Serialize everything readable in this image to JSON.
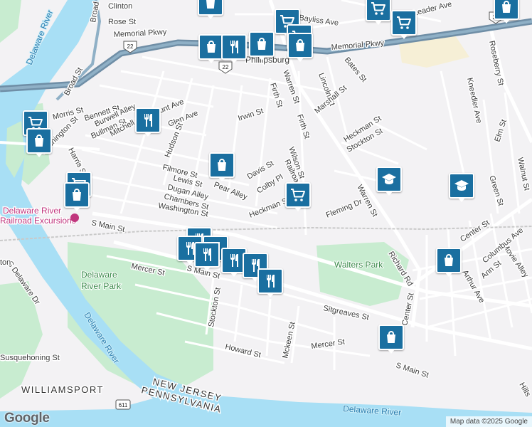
{
  "map": {
    "attribution": "Map data ©2025 Google",
    "logo_text": "Google",
    "water_color": "#a8dff5",
    "park_color": "#c8ecd0",
    "highway_color": "#6f8ea6",
    "pin_color": "#1a6fa0",
    "labels": {
      "broad_st_top": "Broad St",
      "clinton": "Clinton",
      "rose_st": "Rose St",
      "bayliss_ave": "Bayliss Ave",
      "leader_ave": "Leader Ave",
      "memorial_pkwy_left": "Memorial Pkwy",
      "memorial_pkwy_right": "Memorial Pkwy",
      "phillipsburg": "Phillipsburg",
      "broad_st_left": "Broad St",
      "delaware_river_top": "Delaware River",
      "roseberry_st": "Roseberry St",
      "bates_st": "Bates St",
      "lincoln_st": "Lincoln St",
      "marshall_st": "Marshall St",
      "firth_st_top": "Firth St",
      "warren_st_top": "Warren St",
      "kneedler_ave": "Kneedler Ave",
      "morris_st": "Morris St",
      "bennett_st": "Bennett St",
      "burwell_alley": "Burwell Alley",
      "bullman_st": "Bullman St",
      "mitchell_st": "Mitchell St",
      "hunt_ave": "Hunt Ave",
      "glen_ave": "Glen Ave",
      "irwin_st": "Irwin St",
      "hudson_st": "Hudson St",
      "firth_st_mid": "Firth St",
      "heckman_st_top": "Heckman St",
      "stockton_st_top": "Stockton St",
      "elm_st": "Elm St",
      "walnut_st": "Walnut St",
      "harris_st": "Harris St",
      "washington_st_left": "Washington St",
      "filmore_st": "Filmore St",
      "pear_alley": "Pear Alley",
      "wilson_st": "Wilson St",
      "davis_st": "Davis St",
      "colby_pl": "Colby Pl",
      "railroad_ave": "Railroad Ave",
      "lewis_st": "Lewis St",
      "dugan_alley": "Dugan Alley",
      "chambers_st": "Chambers St",
      "heckman_st": "Heckman St",
      "green_st": "Green St",
      "fleming_dr": "Fleming Dr",
      "warren_st": "Warren St",
      "delaware_river_excursions_1": "Delaware River",
      "delaware_river_excursions_2": "Railroad Excursions",
      "washington_st": "Washington St",
      "s_main_st_left": "S Main St",
      "center_st": "Center St",
      "movie_alley": "Movie Alley",
      "columbus_ave": "Columbus Ave",
      "walters_park": "Walters Park",
      "richard_rd": "Richard Rd",
      "ann_st": "Ann St",
      "arthur_ave": "Arthur Ave",
      "s_main_st_mid": "S Main St",
      "mercer_st_left": "Mercer St",
      "stockton_st": "Stockton St",
      "delaware_river_park_1": "Delaware",
      "delaware_river_park_2": "River Park",
      "center_st_vert": "Center St",
      "sitgreaves_st": "Sitgreaves St",
      "s_delaware_dr": "S Delaware Dr",
      "delaware_river_mid": "Delaware River",
      "mckeen_st": "Mckeen St",
      "mercer_st": "Mercer St",
      "howard_st": "Howard St",
      "s_main_st_right": "S Main St",
      "susquehanna_st": "Susquehoning St",
      "williamsport": "WILLIAMSPORT",
      "new_jersey": "NEW JERSEY",
      "pennsylvania": "PENNSYLVANIA",
      "route_611": "611",
      "delaware_river_bottom": "Delaware River",
      "delaware_river_left": "Delaware River",
      "hills": "Hills",
      "ton": "ton",
      "route_22_left": "22",
      "route_22_mid": "22",
      "route_22_right": "22"
    },
    "markers": [
      {
        "icon": "shopping-bag-icon"
      },
      {
        "icon": "shopping-cart-icon"
      },
      {
        "icon": "shopping-cart-icon"
      },
      {
        "icon": "shopping-cart-icon"
      },
      {
        "icon": "shopping-cart-icon"
      },
      {
        "icon": "shopping-bag-icon"
      },
      {
        "icon": "restaurant-icon"
      },
      {
        "icon": "shopping-bag-icon"
      },
      {
        "icon": "shopping-bag-icon"
      },
      {
        "icon": "shopping-bag-icon"
      },
      {
        "icon": "shopping-cart-icon"
      },
      {
        "icon": "shopping-bag-icon"
      },
      {
        "icon": "restaurant-icon"
      },
      {
        "icon": "shopping-bag-icon"
      },
      {
        "icon": "shopping-cart-icon"
      },
      {
        "icon": "shopping-bag-icon"
      },
      {
        "icon": "shopping-cart-icon"
      },
      {
        "icon": "school-icon"
      },
      {
        "icon": "school-icon"
      },
      {
        "icon": "restaurant-icon"
      },
      {
        "icon": "restaurant-icon"
      },
      {
        "icon": "restaurant-icon"
      },
      {
        "icon": "restaurant-icon"
      },
      {
        "icon": "restaurant-icon"
      },
      {
        "icon": "restaurant-icon"
      },
      {
        "icon": "restaurant-icon"
      },
      {
        "icon": "shopping-bag-icon"
      },
      {
        "icon": "shopping-bag-icon"
      }
    ]
  }
}
